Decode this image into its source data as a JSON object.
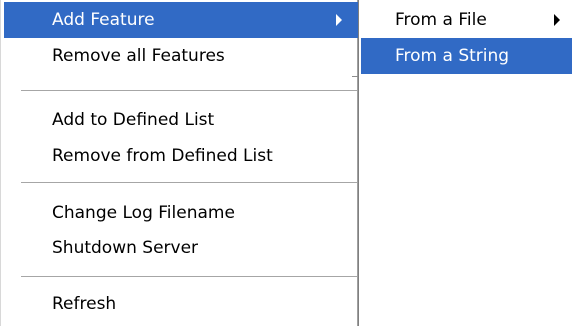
{
  "main_menu": {
    "items": [
      {
        "label": "Add Feature",
        "has_submenu": true,
        "selected": true
      },
      {
        "label": "Remove all Features"
      },
      {
        "label": "Add to Defined List"
      },
      {
        "label": "Remove from Defined List"
      },
      {
        "label": "Change Log Filename"
      },
      {
        "label": "Shutdown Server"
      },
      {
        "label": "Refresh"
      }
    ]
  },
  "submenu": {
    "items": [
      {
        "label": "From a File",
        "has_submenu": true
      },
      {
        "label": "From a String",
        "selected": true
      }
    ]
  },
  "colors": {
    "highlight": "#316ac5",
    "highlight_text": "#ffffff",
    "separator": "#a6a6a6"
  },
  "icons": [
    "submenu-arrow-icon"
  ]
}
